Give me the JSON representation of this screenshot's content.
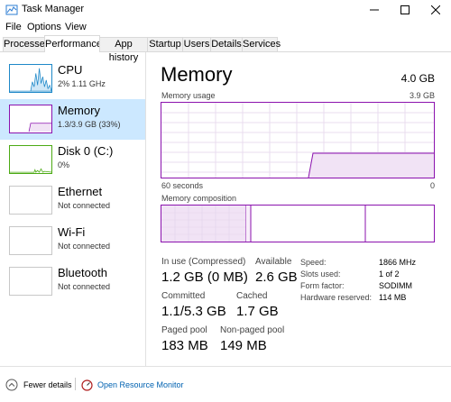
{
  "window": {
    "title": "Task Manager"
  },
  "menu": [
    "File",
    "Options",
    "View"
  ],
  "tabs": [
    "Processes",
    "Performance",
    "App history",
    "Startup",
    "Users",
    "Details",
    "Services"
  ],
  "sidebar": {
    "items": [
      {
        "title": "CPU",
        "subtitle": "2%  1.11 GHz",
        "icon": "cpu-graph"
      },
      {
        "title": "Memory",
        "subtitle": "1.3/3.9 GB (33%)",
        "icon": "memory-graph"
      },
      {
        "title": "Disk 0 (C:)",
        "subtitle": "0%",
        "icon": "disk-graph"
      },
      {
        "title": "Ethernet",
        "subtitle": "Not connected",
        "icon": "ethernet-graph"
      },
      {
        "title": "Wi-Fi",
        "subtitle": "Not connected",
        "icon": "wifi-graph"
      },
      {
        "title": "Bluetooth",
        "subtitle": "Not connected",
        "icon": "bluetooth-graph"
      }
    ]
  },
  "main": {
    "title": "Memory",
    "total": "4.0 GB",
    "usage_label": "Memory usage",
    "usage_max": "3.9 GB",
    "time_left": "60 seconds",
    "time_right": "0",
    "composition_label": "Memory composition",
    "stats": [
      {
        "label": "In use (Compressed)",
        "value": "1.2 GB (0 MB)"
      },
      {
        "label": "Available",
        "value": "2.6 GB"
      },
      {
        "label": "Committed",
        "value": "1.1/5.3 GB"
      },
      {
        "label": "Cached",
        "value": "1.7 GB"
      },
      {
        "label": "Paged pool",
        "value": "183 MB"
      },
      {
        "label": "Non-paged pool",
        "value": "149 MB"
      }
    ],
    "specs": [
      {
        "label": "Speed:",
        "value": "1866 MHz"
      },
      {
        "label": "Slots used:",
        "value": "1 of 2"
      },
      {
        "label": "Form factor:",
        "value": "SODIMM"
      },
      {
        "label": "Hardware reserved:",
        "value": "114 MB"
      }
    ]
  },
  "footer": {
    "fewer_details": "Fewer details",
    "resource_monitor": "Open Resource Monitor"
  },
  "colors": {
    "memory": "#8b12ae",
    "cpu": "#1e88c8",
    "disk": "#4caa14",
    "selected": "#cce8ff",
    "link": "#0062b1"
  }
}
